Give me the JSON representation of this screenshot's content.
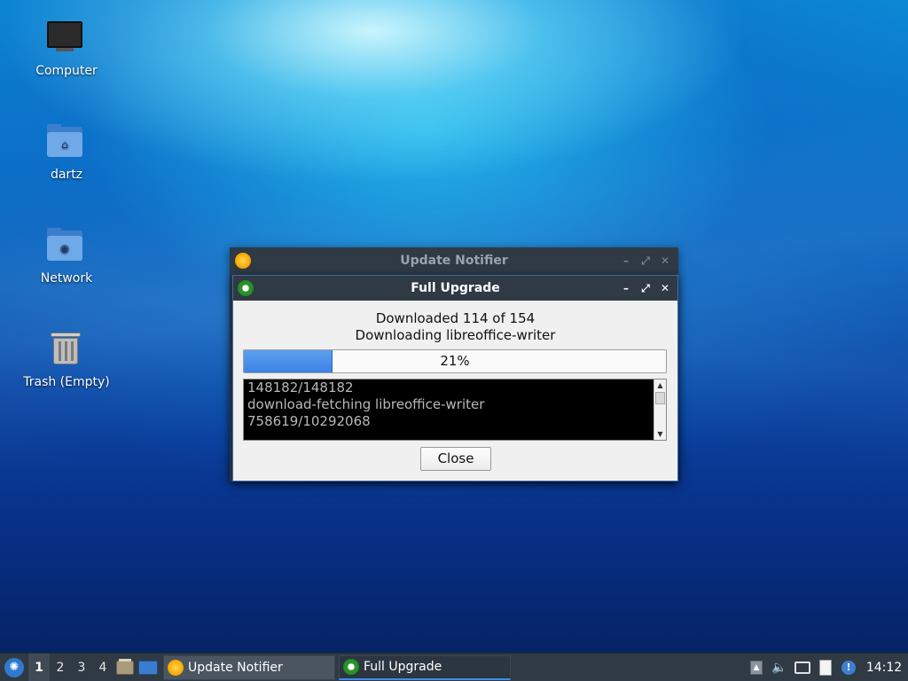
{
  "desktop": {
    "icons": [
      {
        "label": "Computer"
      },
      {
        "label": "dartz"
      },
      {
        "label": "Network"
      },
      {
        "label": "Trash (Empty)"
      }
    ]
  },
  "notifier_window": {
    "title": "Update Notifier",
    "buttons": {
      "minimize": "–",
      "maximize": "⤢",
      "close": "✕"
    }
  },
  "upgrade_window": {
    "title": "Full Upgrade",
    "buttons": {
      "minimize": "–",
      "maximize": "⤢",
      "close": "✕"
    },
    "status_line1": "Downloaded 114 of 154",
    "status_line2": "Downloading libreoffice-writer",
    "progress": {
      "value": 21,
      "label": "21%"
    },
    "log_lines": [
      "148182/148182",
      "download-fetching libreoffice-writer",
      "758619/10292068"
    ],
    "close_label": "Close"
  },
  "taskbar": {
    "workspaces": [
      "1",
      "2",
      "3",
      "4"
    ],
    "active_workspace": "1",
    "tasks": [
      {
        "label": "Update Notifier"
      },
      {
        "label": "Full Upgrade"
      }
    ],
    "clock": "14:12"
  },
  "colors": {
    "titlebar": "#2f3a45",
    "progress_fill": "#3b82e4",
    "taskbar": "#303a44"
  }
}
